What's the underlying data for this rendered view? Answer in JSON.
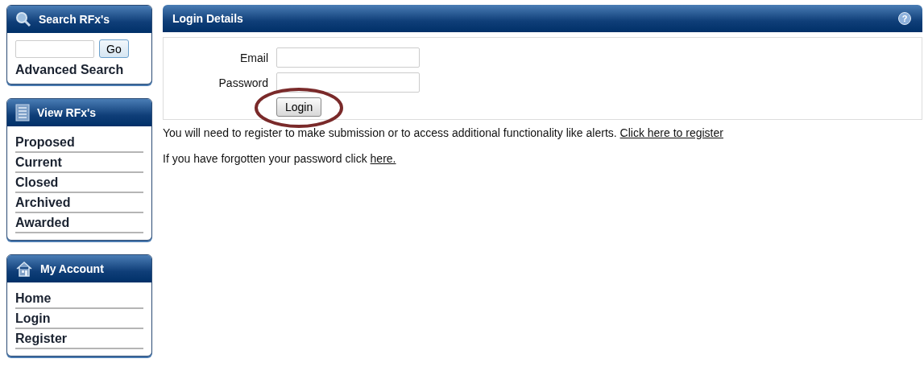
{
  "sidebar": [
    {
      "kind": "search",
      "title": "Search RFx's",
      "button": "Go",
      "link": "Advanced Search"
    },
    {
      "kind": "list",
      "title": "View RFx's",
      "items": [
        "Proposed",
        "Current",
        "Closed",
        "Archived",
        "Awarded"
      ]
    },
    {
      "kind": "list",
      "title": "My Account",
      "items": [
        "Home",
        "Login",
        "Register"
      ]
    }
  ],
  "panel": {
    "title": "Login Details",
    "help": "?",
    "fields": [
      {
        "label": "Email"
      },
      {
        "label": "Password"
      }
    ],
    "button": "Login",
    "button_highlighted": true
  },
  "register_note": {
    "text": "You will need to register to make submission or to access additional functionality like alerts.",
    "link": "Click here to register"
  },
  "forgot_note": {
    "text": "If you have forgotten your password click",
    "link": "here."
  }
}
